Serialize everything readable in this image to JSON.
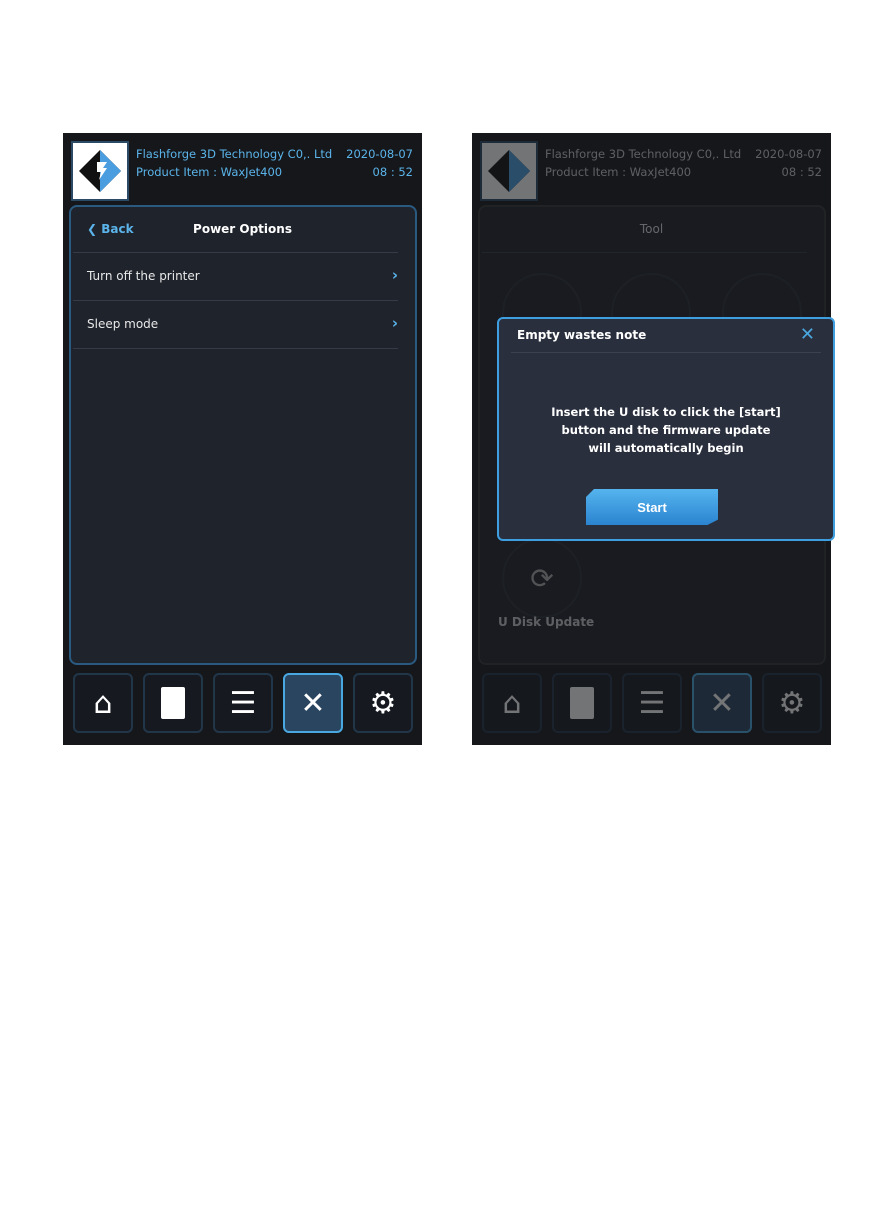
{
  "header": {
    "company": "Flashforge 3D Technology C0,. Ltd",
    "product": "Product Item : WaxJet400",
    "date": "2020-08-07",
    "time": "08 : 52"
  },
  "screen1": {
    "back_label": "Back",
    "title": "Power Options",
    "items": [
      {
        "label": "Turn off the printer"
      },
      {
        "label": "Sleep mode"
      }
    ]
  },
  "screen2": {
    "title": "Tool",
    "tool_label": "U Disk Update",
    "modal": {
      "title": "Empty wastes note",
      "lines": [
        "Insert the U disk to click the [start]",
        "button and the firmware update",
        "will automatically begin"
      ],
      "start_label": "Start"
    }
  },
  "nav": [
    "home-icon",
    "material-bottle-icon",
    "list-icon",
    "tools-icon",
    "settings-gear-icon"
  ],
  "active_nav": "tools-icon",
  "colors": {
    "accent": "#5bb4ea",
    "background": "#15171b"
  }
}
